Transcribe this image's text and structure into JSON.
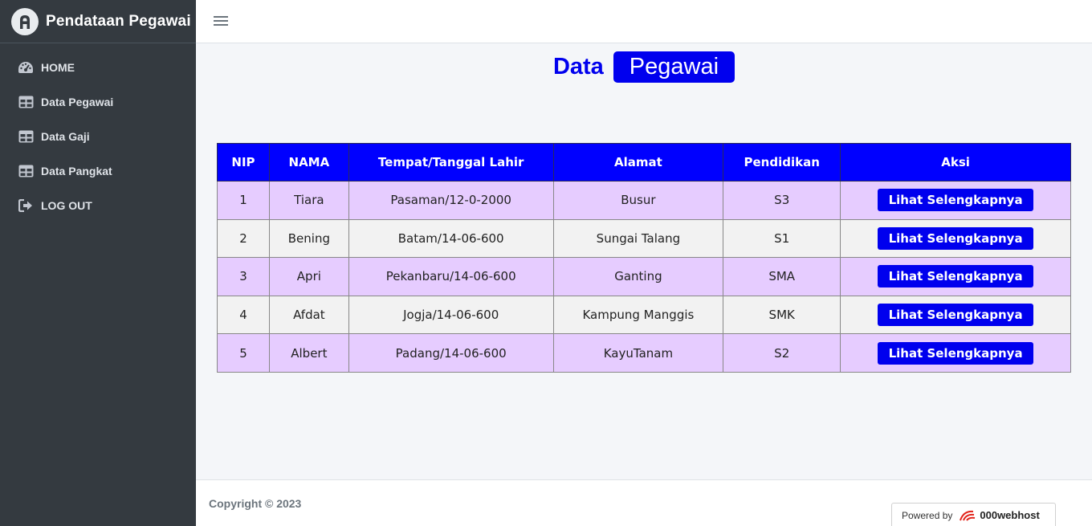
{
  "brand": {
    "title": "Pendataan Pegawai"
  },
  "sidebar": {
    "items": [
      {
        "label": "HOME",
        "icon": "dashboard-icon"
      },
      {
        "label": "Data Pegawai",
        "icon": "table-icon"
      },
      {
        "label": "Data Gaji",
        "icon": "table-icon"
      },
      {
        "label": "Data Pangkat",
        "icon": "table-icon"
      },
      {
        "label": "LOG OUT",
        "icon": "logout-icon"
      }
    ]
  },
  "header": {
    "menu_icon": "hamburger-icon"
  },
  "page": {
    "title_word": "Data",
    "title_badge": "Pegawai"
  },
  "table": {
    "headers": [
      "NIP",
      "NAMA",
      "Tempat/Tanggal Lahir",
      "Alamat",
      "Pendidikan",
      "Aksi"
    ],
    "rows": [
      {
        "nip": "1",
        "nama": "Tiara",
        "ttl": "Pasaman/12-0-2000",
        "alamat": "Busur",
        "pendidikan": "S3",
        "aksi": "Lihat Selengkapnya"
      },
      {
        "nip": "2",
        "nama": "Bening",
        "ttl": "Batam/14-06-600",
        "alamat": "Sungai Talang",
        "pendidikan": "S1",
        "aksi": "Lihat Selengkapnya"
      },
      {
        "nip": "3",
        "nama": "Apri",
        "ttl": "Pekanbaru/14-06-600",
        "alamat": "Ganting",
        "pendidikan": "SMA",
        "aksi": "Lihat Selengkapnya"
      },
      {
        "nip": "4",
        "nama": "Afdat",
        "ttl": "Jogja/14-06-600",
        "alamat": "Kampung Manggis",
        "pendidikan": "SMK",
        "aksi": "Lihat Selengkapnya"
      },
      {
        "nip": "5",
        "nama": "Albert",
        "ttl": "Padang/14-06-600",
        "alamat": "KayuTanam",
        "pendidikan": "S2",
        "aksi": "Lihat Selengkapnya"
      }
    ]
  },
  "footer": {
    "copyright": "Copyright © 2023",
    "powered_label": "Powered by",
    "powered_brand": "000webhost"
  },
  "colors": {
    "sidebar": "#343a40",
    "accent": "#0000ee",
    "row_odd": "#e6ccff",
    "row_even": "#f2f2f2"
  }
}
